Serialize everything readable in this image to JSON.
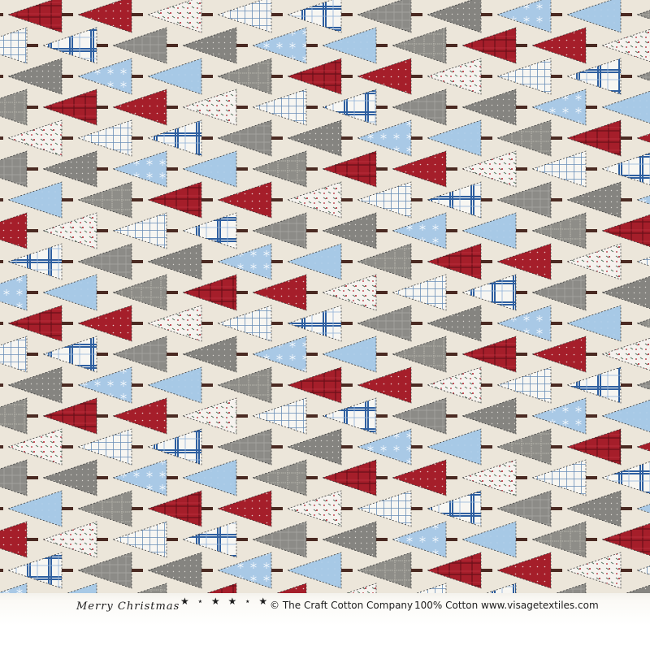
{
  "selvedge": {
    "slogan": "Merry Christmas",
    "stars": "★ ⋆ ★ ★ ⋆ ★",
    "copyright": "© The Craft Cotton Company",
    "fibre": "100% Cotton",
    "website": "www.visagetextiles.com"
  },
  "fabric": {
    "background_color": "#ece6da",
    "tree_styles": [
      "red-plaid",
      "red-solid",
      "white-holly",
      "white-gingham",
      "blue-tartan",
      "grey-plaid",
      "grey-dot",
      "blue-snowflake",
      "blue-solid",
      "grey-check"
    ],
    "colors": {
      "red": "#a51e2a",
      "grey": "#8a8985",
      "light_blue": "#a7c9e6",
      "tartan_blue": "#2e5fa0",
      "white": "#f7f6f2",
      "trunk": "#4a2a22"
    }
  }
}
